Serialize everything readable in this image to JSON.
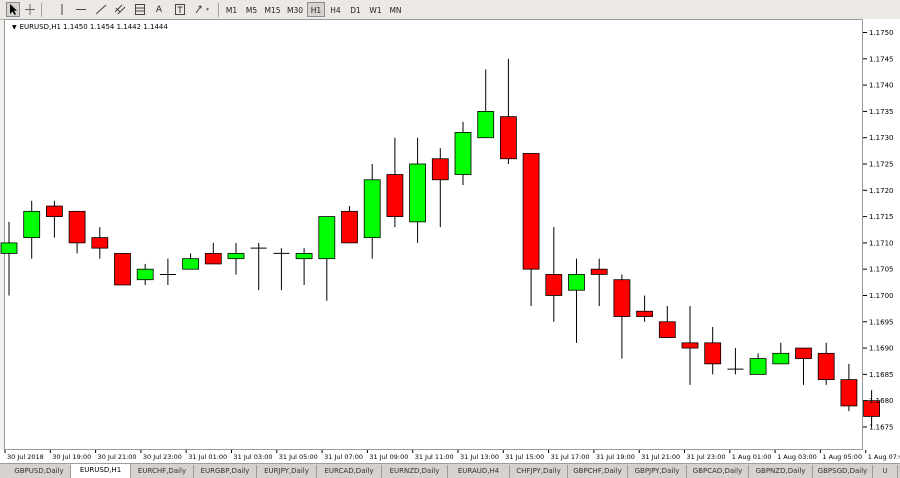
{
  "toolbar": {
    "timeframes": [
      "M1",
      "M5",
      "M15",
      "M30",
      "H1",
      "H4",
      "D1",
      "W1",
      "MN"
    ],
    "active_timeframe": "H1",
    "text_tool": "A"
  },
  "chart_header": {
    "title": "EURUSD,H1  1.1450 1.1454 1.1442 1.1444"
  },
  "colors": {
    "bull": "#00ff00",
    "bear": "#ff0000",
    "wick": "#000000",
    "grid": "#ffffff"
  },
  "chart_data": {
    "type": "candlestick",
    "symbol": "EURUSD",
    "timeframe": "H1",
    "ylim": [
      1.1671,
      1.1752
    ],
    "yticks": [
      "1.1750",
      "1.1745",
      "1.1740",
      "1.1735",
      "1.1730",
      "1.1725",
      "1.1720",
      "1.1715",
      "1.1710",
      "1.1705",
      "1.1700",
      "1.1695",
      "1.1690",
      "1.1685",
      "1.1680",
      "1.1675"
    ],
    "xticks": [
      "30 Jul 2018",
      "30 Jul 19:00",
      "30 Jul 21:00",
      "30 Jul 23:00",
      "31 Jul 01:00",
      "31 Jul 03:00",
      "31 Jul 05:00",
      "31 Jul 07:00",
      "31 Jul 09:00",
      "31 Jul 11:00",
      "31 Jul 13:00",
      "31 Jul 15:00",
      "31 Jul 17:00",
      "31 Jul 19:00",
      "31 Jul 21:00",
      "31 Jul 23:00",
      "1 Aug 01:00",
      "1 Aug 03:00",
      "1 Aug 05:00",
      "1 Aug 07:00"
    ],
    "grid": false,
    "candles": [
      {
        "o": 1.1708,
        "h": 1.1714,
        "l": 1.17,
        "c": 1.171
      },
      {
        "o": 1.1711,
        "h": 1.1718,
        "l": 1.1707,
        "c": 1.1716
      },
      {
        "o": 1.1717,
        "h": 1.1718,
        "l": 1.1711,
        "c": 1.1715
      },
      {
        "o": 1.1716,
        "h": 1.1716,
        "l": 1.1708,
        "c": 1.171
      },
      {
        "o": 1.1711,
        "h": 1.1713,
        "l": 1.1707,
        "c": 1.1709
      },
      {
        "o": 1.1708,
        "h": 1.1708,
        "l": 1.1702,
        "c": 1.1702
      },
      {
        "o": 1.1703,
        "h": 1.1706,
        "l": 1.1702,
        "c": 1.1705
      },
      {
        "o": 1.1704,
        "h": 1.1707,
        "l": 1.1702,
        "c": 1.1704
      },
      {
        "o": 1.1705,
        "h": 1.1708,
        "l": 1.1705,
        "c": 1.1707
      },
      {
        "o": 1.1708,
        "h": 1.171,
        "l": 1.1706,
        "c": 1.1706
      },
      {
        "o": 1.1707,
        "h": 1.171,
        "l": 1.1704,
        "c": 1.1708
      },
      {
        "o": 1.1709,
        "h": 1.171,
        "l": 1.1701,
        "c": 1.1709
      },
      {
        "o": 1.1708,
        "h": 1.1709,
        "l": 1.1701,
        "c": 1.1708
      },
      {
        "o": 1.1707,
        "h": 1.1709,
        "l": 1.1702,
        "c": 1.1708
      },
      {
        "o": 1.1707,
        "h": 1.1715,
        "l": 1.1699,
        "c": 1.1715
      },
      {
        "o": 1.1716,
        "h": 1.1717,
        "l": 1.171,
        "c": 1.171
      },
      {
        "o": 1.1711,
        "h": 1.1725,
        "l": 1.1707,
        "c": 1.1722
      },
      {
        "o": 1.1723,
        "h": 1.173,
        "l": 1.1713,
        "c": 1.1715
      },
      {
        "o": 1.1714,
        "h": 1.173,
        "l": 1.171,
        "c": 1.1725
      },
      {
        "o": 1.1726,
        "h": 1.1728,
        "l": 1.1713,
        "c": 1.1722
      },
      {
        "o": 1.1723,
        "h": 1.1733,
        "l": 1.1721,
        "c": 1.1731
      },
      {
        "o": 1.173,
        "h": 1.1743,
        "l": 1.173,
        "c": 1.1735
      },
      {
        "o": 1.1734,
        "h": 1.1745,
        "l": 1.1725,
        "c": 1.1726
      },
      {
        "o": 1.1727,
        "h": 1.1727,
        "l": 1.1698,
        "c": 1.1705
      },
      {
        "o": 1.1704,
        "h": 1.1713,
        "l": 1.1695,
        "c": 1.17
      },
      {
        "o": 1.1701,
        "h": 1.1707,
        "l": 1.1691,
        "c": 1.1704
      },
      {
        "o": 1.1705,
        "h": 1.1707,
        "l": 1.1698,
        "c": 1.1704
      },
      {
        "o": 1.1703,
        "h": 1.1704,
        "l": 1.1688,
        "c": 1.1696
      },
      {
        "o": 1.1697,
        "h": 1.17,
        "l": 1.1695,
        "c": 1.1696
      },
      {
        "o": 1.1695,
        "h": 1.1698,
        "l": 1.1692,
        "c": 1.1692
      },
      {
        "o": 1.1691,
        "h": 1.1698,
        "l": 1.1683,
        "c": 1.169
      },
      {
        "o": 1.1691,
        "h": 1.1694,
        "l": 1.1685,
        "c": 1.1687
      },
      {
        "o": 1.1686,
        "h": 1.169,
        "l": 1.1685,
        "c": 1.1686
      },
      {
        "o": 1.1685,
        "h": 1.1689,
        "l": 1.1685,
        "c": 1.1688
      },
      {
        "o": 1.1687,
        "h": 1.1691,
        "l": 1.1687,
        "c": 1.1689
      },
      {
        "o": 1.169,
        "h": 1.169,
        "l": 1.1683,
        "c": 1.1688
      },
      {
        "o": 1.1689,
        "h": 1.1691,
        "l": 1.1683,
        "c": 1.1684
      },
      {
        "o": 1.1684,
        "h": 1.1687,
        "l": 1.1678,
        "c": 1.1679
      },
      {
        "o": 1.168,
        "h": 1.1682,
        "l": 1.1675,
        "c": 1.1677
      }
    ]
  },
  "tabs": [
    {
      "label": "GBPUSD,Daily"
    },
    {
      "label": "EURUSD,H1",
      "active": true
    },
    {
      "label": "EURCHF,Daily"
    },
    {
      "label": "EURGBP,Daily"
    },
    {
      "label": "EURJPY,Daily"
    },
    {
      "label": "EURCAD,Daily"
    },
    {
      "label": "EURNZD,Daily"
    },
    {
      "label": "EURAUD,H4"
    },
    {
      "label": "CHFJPY,Daily"
    },
    {
      "label": "GBPCHF,Daily"
    },
    {
      "label": "GBPJPY,Daily"
    },
    {
      "label": "GBPCAD,Daily"
    },
    {
      "label": "GBPNZD,Daily"
    },
    {
      "label": "GBPSGD,Daily"
    },
    {
      "label": "U"
    }
  ]
}
